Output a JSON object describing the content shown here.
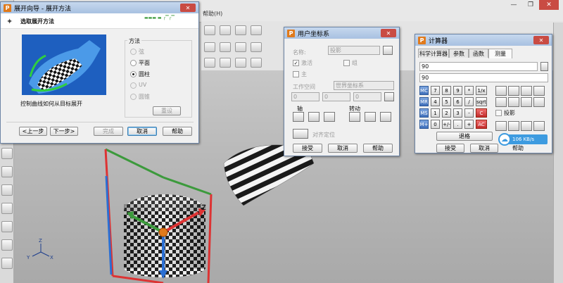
{
  "app": {
    "menu": [
      "帮助(H)"
    ],
    "colors": {
      "title_gradient": "#a8c1e1",
      "close": "#c94b43",
      "accent_orange": "#e07a1c"
    }
  },
  "unfold_wizard": {
    "title": "展开向导 - 展开方法",
    "heading": "选取展开方法",
    "step_indicator": "▬▬▬ ▬ ┌▔┌▔",
    "caption": "控制曲线如何从目标展开",
    "method_label": "方法",
    "options": [
      {
        "label": "弦",
        "selected": false,
        "enabled": false
      },
      {
        "label": "平面",
        "selected": false,
        "enabled": true
      },
      {
        "label": "圆柱",
        "selected": true,
        "enabled": true
      },
      {
        "label": "UV",
        "selected": false,
        "enabled": false
      },
      {
        "label": "圆锥",
        "selected": false,
        "enabled": false
      }
    ],
    "reset_btn": "重设",
    "buttons": {
      "prev": "<上一步",
      "next": "下一步>",
      "finish": "完成",
      "cancel": "取消",
      "help": "帮助"
    }
  },
  "ucs_dialog": {
    "title": "用户坐标系",
    "name_label": "名称:",
    "name_value": "投影",
    "active_label": "激活",
    "group_label": "组",
    "main_label": "主",
    "workspace_label": "工作空间",
    "workspace_value": "世界坐标系",
    "coords": [
      "0",
      "0",
      "0"
    ],
    "axis_label": "轴",
    "rotate_label": "转动",
    "align_label": "对齐定位",
    "buttons": {
      "accept": "接受",
      "cancel": "取消",
      "help": "帮助"
    }
  },
  "calculator": {
    "title": "计算器",
    "tabs": [
      "科学计算器",
      "参数",
      "函数",
      "测量"
    ],
    "active_tab": "测量",
    "display_top": "90",
    "display_bottom": "90",
    "keypad": [
      [
        "MC",
        "7",
        "8",
        "9",
        "*",
        "1/x"
      ],
      [
        "MR",
        "4",
        "5",
        "6",
        "/",
        "sqrt"
      ],
      [
        "MS",
        "1",
        "2",
        "3",
        "-",
        "C"
      ],
      [
        "M+",
        "0",
        "+/-",
        ".",
        "+",
        "AC"
      ]
    ],
    "backspace": "退格",
    "projection_label": "投影",
    "net_speed": "106 KB/s",
    "buttons": {
      "accept": "接受",
      "cancel": "取消",
      "help": "帮助"
    }
  },
  "viewport": {
    "axis_z": "Z",
    "axis_y": "Y",
    "axis_x": "X"
  }
}
